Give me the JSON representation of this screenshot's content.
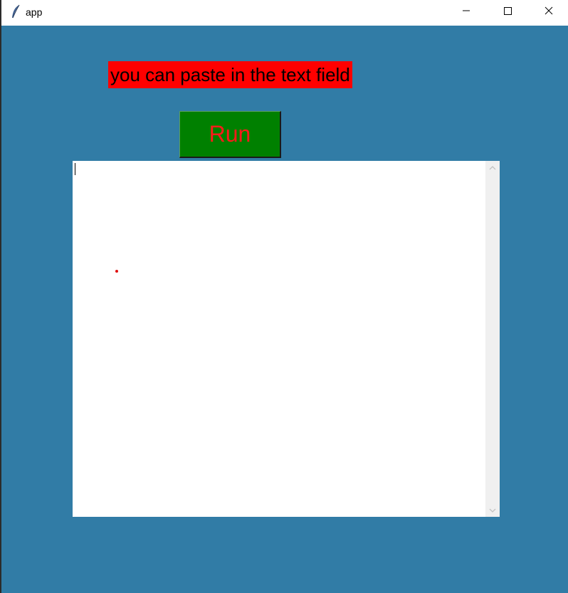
{
  "window": {
    "title": "app",
    "icon": "feather-icon",
    "controls": [
      "minimize-icon",
      "maximize-icon",
      "close-icon"
    ]
  },
  "main": {
    "label_text": "you can paste in the text field",
    "run_button_label": "Run",
    "text_field_value": ""
  },
  "colors": {
    "background": "#317ca6",
    "label_background": "#ff0000",
    "label_text": "#000000",
    "button_background": "#008000",
    "button_text": "#ff1a1a",
    "text_field_background": "#ffffff",
    "scrollbar_track": "#f0f0f0"
  }
}
